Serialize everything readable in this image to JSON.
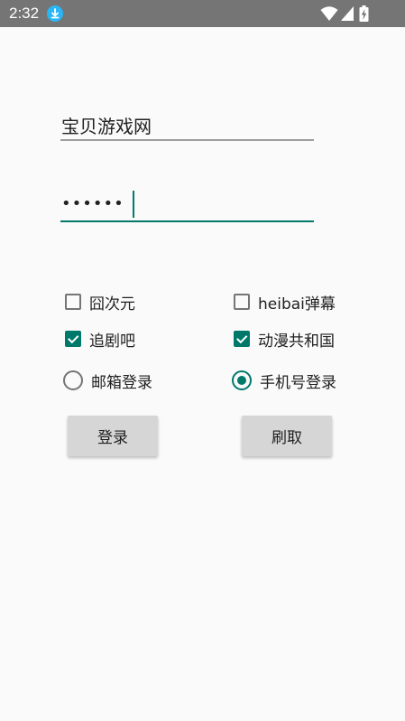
{
  "status_bar": {
    "time": "2:32",
    "icons": [
      "download-icon",
      "wifi-icon",
      "signal-icon",
      "battery-charging-icon"
    ]
  },
  "form": {
    "username_value": "宝贝游戏网",
    "password_value": "••••••"
  },
  "checkboxes": [
    {
      "label": "囧次元",
      "checked": false
    },
    {
      "label": "heibai弹幕",
      "checked": false
    },
    {
      "label": "追剧吧",
      "checked": true
    },
    {
      "label": "动漫共和国",
      "checked": true
    }
  ],
  "radios": [
    {
      "label": "邮箱登录",
      "checked": false
    },
    {
      "label": "手机号登录",
      "checked": true
    }
  ],
  "buttons": {
    "login_label": "登录",
    "refresh_label": "刷取"
  },
  "colors": {
    "accent": "#00796b",
    "status_bar": "#757575",
    "background": "#fafafa",
    "button": "#d6d6d6"
  }
}
